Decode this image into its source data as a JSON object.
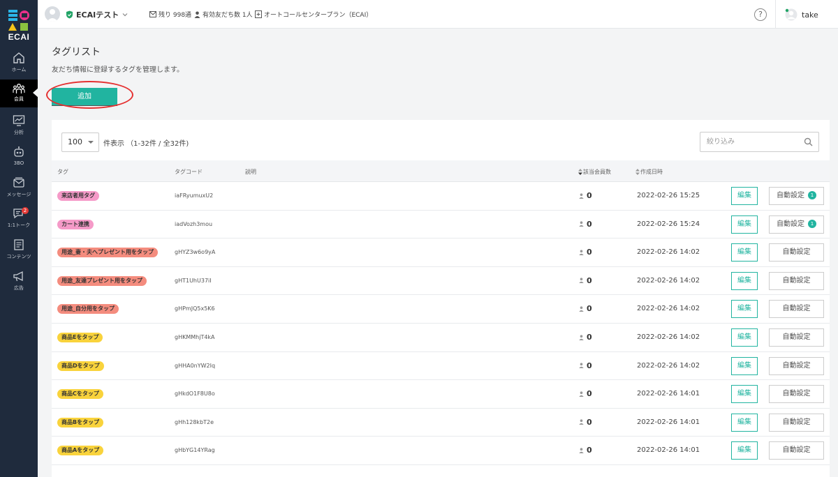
{
  "sidebar": {
    "logo_text": "ECAI",
    "items": [
      {
        "label": "ホーム",
        "icon": "home-icon"
      },
      {
        "label": "会員",
        "icon": "members-icon",
        "active": true
      },
      {
        "label": "分析",
        "icon": "analytics-icon"
      },
      {
        "label": "3BO",
        "icon": "robot-icon"
      },
      {
        "label": "メッセージ",
        "icon": "message-icon"
      },
      {
        "label": "1:1トーク",
        "icon": "chat-icon",
        "badge": "2"
      },
      {
        "label": "コンテンツ",
        "icon": "content-icon"
      },
      {
        "label": "広告",
        "icon": "megaphone-icon"
      }
    ]
  },
  "header": {
    "account_name": "ECAIテスト",
    "remaining": "残り 998通",
    "friends": "有効友だち数 1人",
    "plan": "オートコールセンタープラン（ECAI）",
    "help": "?",
    "user_name": "take"
  },
  "page": {
    "title": "タグリスト",
    "description": "友だち情報に登録するタグを管理します。",
    "add_button": "追加"
  },
  "table_controls": {
    "per_page": "100",
    "count_text": "件表示 （1-32件 / 全32件)",
    "filter_placeholder": "絞り込み"
  },
  "columns": {
    "tag": "タグ",
    "tag_code": "タグコード",
    "description": "説明",
    "members": "該当会員数",
    "created": "作成日時"
  },
  "buttons": {
    "edit": "編集",
    "auto": "自動設定"
  },
  "colors": {
    "accent": "#21b4a0",
    "sidebar": "#1f2b3d",
    "pink": "#f59ac8",
    "salmon": "#f48c7e",
    "yellow": "#f9d33c",
    "orange": "#f5922f"
  },
  "rows": [
    {
      "tag": "来店者用タグ",
      "color": "#f59ac8",
      "code": "iaFRyumuxU2",
      "members": "0",
      "created": "2022-02-26 15:25",
      "auto_badge": "1"
    },
    {
      "tag": "カート連携",
      "color": "#f59ac8",
      "code": "iadVozh3mou",
      "members": "0",
      "created": "2022-02-26 15:24",
      "auto_badge": "1"
    },
    {
      "tag": "用途_妻・夫へプレゼント用をタップ",
      "color": "#f48c7e",
      "code": "gHYZ3w6o9yA",
      "members": "0",
      "created": "2022-02-26 14:02",
      "auto_badge": ""
    },
    {
      "tag": "用途_友達プレゼント用をタップ",
      "color": "#f48c7e",
      "code": "gHT1UhU37iI",
      "members": "0",
      "created": "2022-02-26 14:02",
      "auto_badge": ""
    },
    {
      "tag": "用途_自分用をタップ",
      "color": "#f48c7e",
      "code": "gHPmJQ5x5K6",
      "members": "0",
      "created": "2022-02-26 14:02",
      "auto_badge": ""
    },
    {
      "tag": "商品Eをタップ",
      "color": "#f9d33c",
      "code": "gHKMMhjT4kA",
      "members": "0",
      "created": "2022-02-26 14:02",
      "auto_badge": ""
    },
    {
      "tag": "商品Dをタップ",
      "color": "#f9d33c",
      "code": "gHHA0nYW2Iq",
      "members": "0",
      "created": "2022-02-26 14:02",
      "auto_badge": ""
    },
    {
      "tag": "商品Cをタップ",
      "color": "#f9d33c",
      "code": "gHkdO1F8U8o",
      "members": "0",
      "created": "2022-02-26 14:01",
      "auto_badge": ""
    },
    {
      "tag": "商品Bをタップ",
      "color": "#f9d33c",
      "code": "gHh128kbT2e",
      "members": "0",
      "created": "2022-02-26 14:01",
      "auto_badge": ""
    },
    {
      "tag": "商品Aをタップ",
      "color": "#f9d33c",
      "code": "gHbYG14YRag",
      "members": "0",
      "created": "2022-02-26 14:01",
      "auto_badge": ""
    }
  ]
}
